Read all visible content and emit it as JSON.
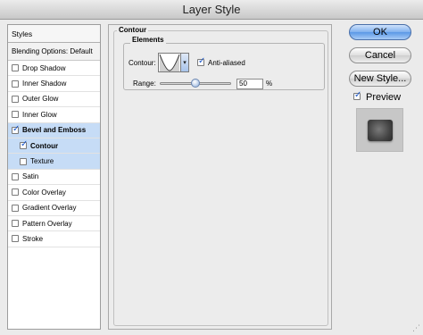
{
  "window": {
    "title": "Layer Style"
  },
  "styles_panel": {
    "header": "Styles",
    "blending_options": "Blending Options: Default",
    "items": [
      {
        "label": "Drop Shadow",
        "checked": false,
        "sub": false
      },
      {
        "label": "Inner Shadow",
        "checked": false,
        "sub": false
      },
      {
        "label": "Outer Glow",
        "checked": false,
        "sub": false
      },
      {
        "label": "Inner Glow",
        "checked": false,
        "sub": false
      },
      {
        "label": "Bevel and Emboss",
        "checked": true,
        "sub": false
      },
      {
        "label": "Contour",
        "checked": true,
        "sub": true
      },
      {
        "label": "Texture",
        "checked": false,
        "sub": true
      },
      {
        "label": "Satin",
        "checked": false,
        "sub": false
      },
      {
        "label": "Color Overlay",
        "checked": false,
        "sub": false
      },
      {
        "label": "Gradient Overlay",
        "checked": false,
        "sub": false
      },
      {
        "label": "Pattern Overlay",
        "checked": false,
        "sub": false
      },
      {
        "label": "Stroke",
        "checked": false,
        "sub": false
      }
    ]
  },
  "content": {
    "group_title": "Contour",
    "elements_title": "Elements",
    "contour_label": "Contour:",
    "contour_dropdown_arrow": "▾",
    "anti_aliased_label": "Anti-aliased",
    "anti_aliased_checked": true,
    "range_label": "Range:",
    "range_value": "50",
    "range_unit": "%",
    "range_slider_value": 0.5
  },
  "buttons": {
    "ok": "OK",
    "cancel": "Cancel",
    "new_style": "New Style...",
    "preview_label": "Preview",
    "preview_checked": true
  },
  "colors": {
    "selected_row": "#c6dcf6",
    "primary_button": "#5b98e6",
    "checkmark": "#1a56c8"
  }
}
